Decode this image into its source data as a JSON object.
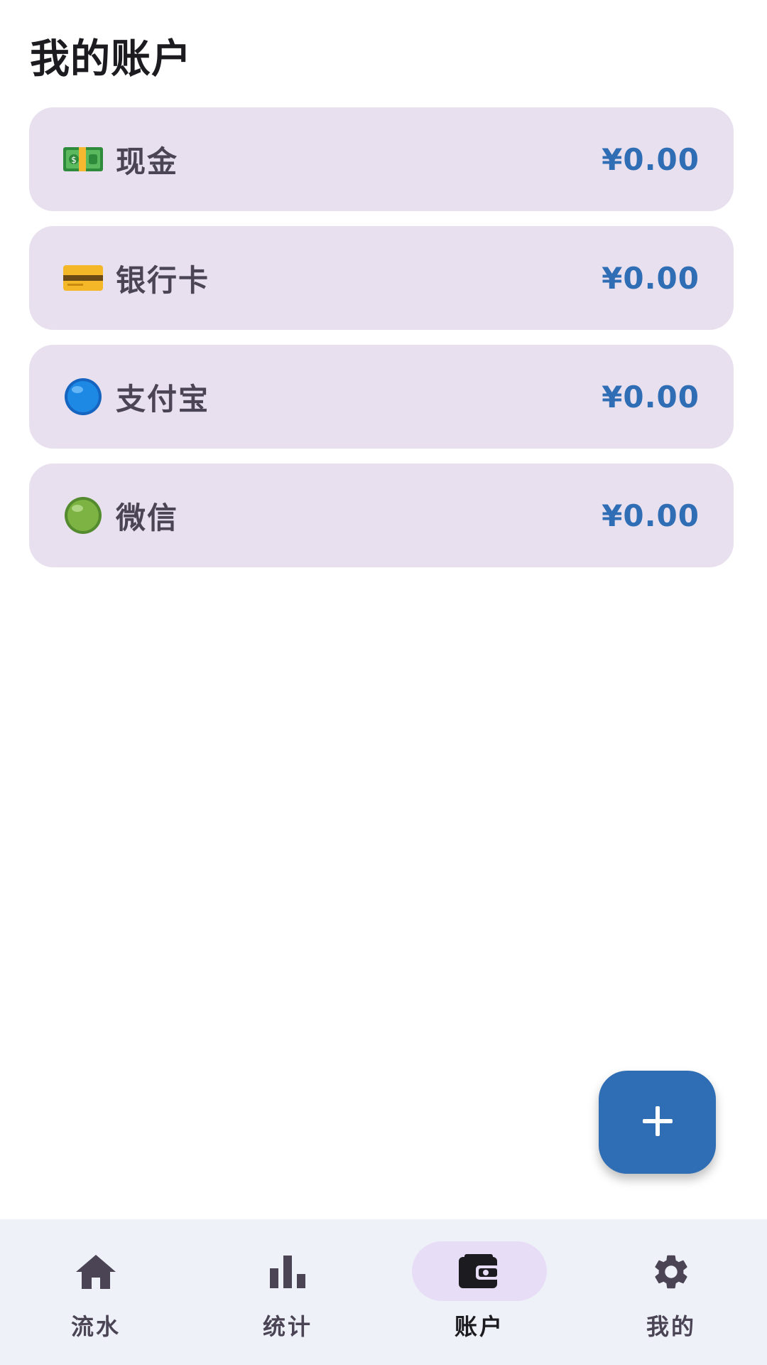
{
  "header": {
    "title": "我的账户"
  },
  "accounts": [
    {
      "name": "现金",
      "balance": "¥0.00",
      "icon": "banknote-icon"
    },
    {
      "name": "银行卡",
      "balance": "¥0.00",
      "icon": "credit-card-icon"
    },
    {
      "name": "支付宝",
      "balance": "¥0.00",
      "icon": "blue-circle-icon"
    },
    {
      "name": "微信",
      "balance": "¥0.00",
      "icon": "green-circle-icon"
    }
  ],
  "fab": {
    "icon": "plus-icon"
  },
  "bottom_nav": {
    "active_index": 2,
    "items": [
      {
        "label": "流水",
        "icon": "home-icon"
      },
      {
        "label": "统计",
        "icon": "bar-chart-icon"
      },
      {
        "label": "账户",
        "icon": "wallet-icon"
      },
      {
        "label": "我的",
        "icon": "gear-icon"
      }
    ]
  },
  "colors": {
    "accent": "#2f6db5",
    "card_background": "#e8e0ee",
    "nav_background": "#eef1f8",
    "nav_active_indicator": "#e8ddf6"
  }
}
